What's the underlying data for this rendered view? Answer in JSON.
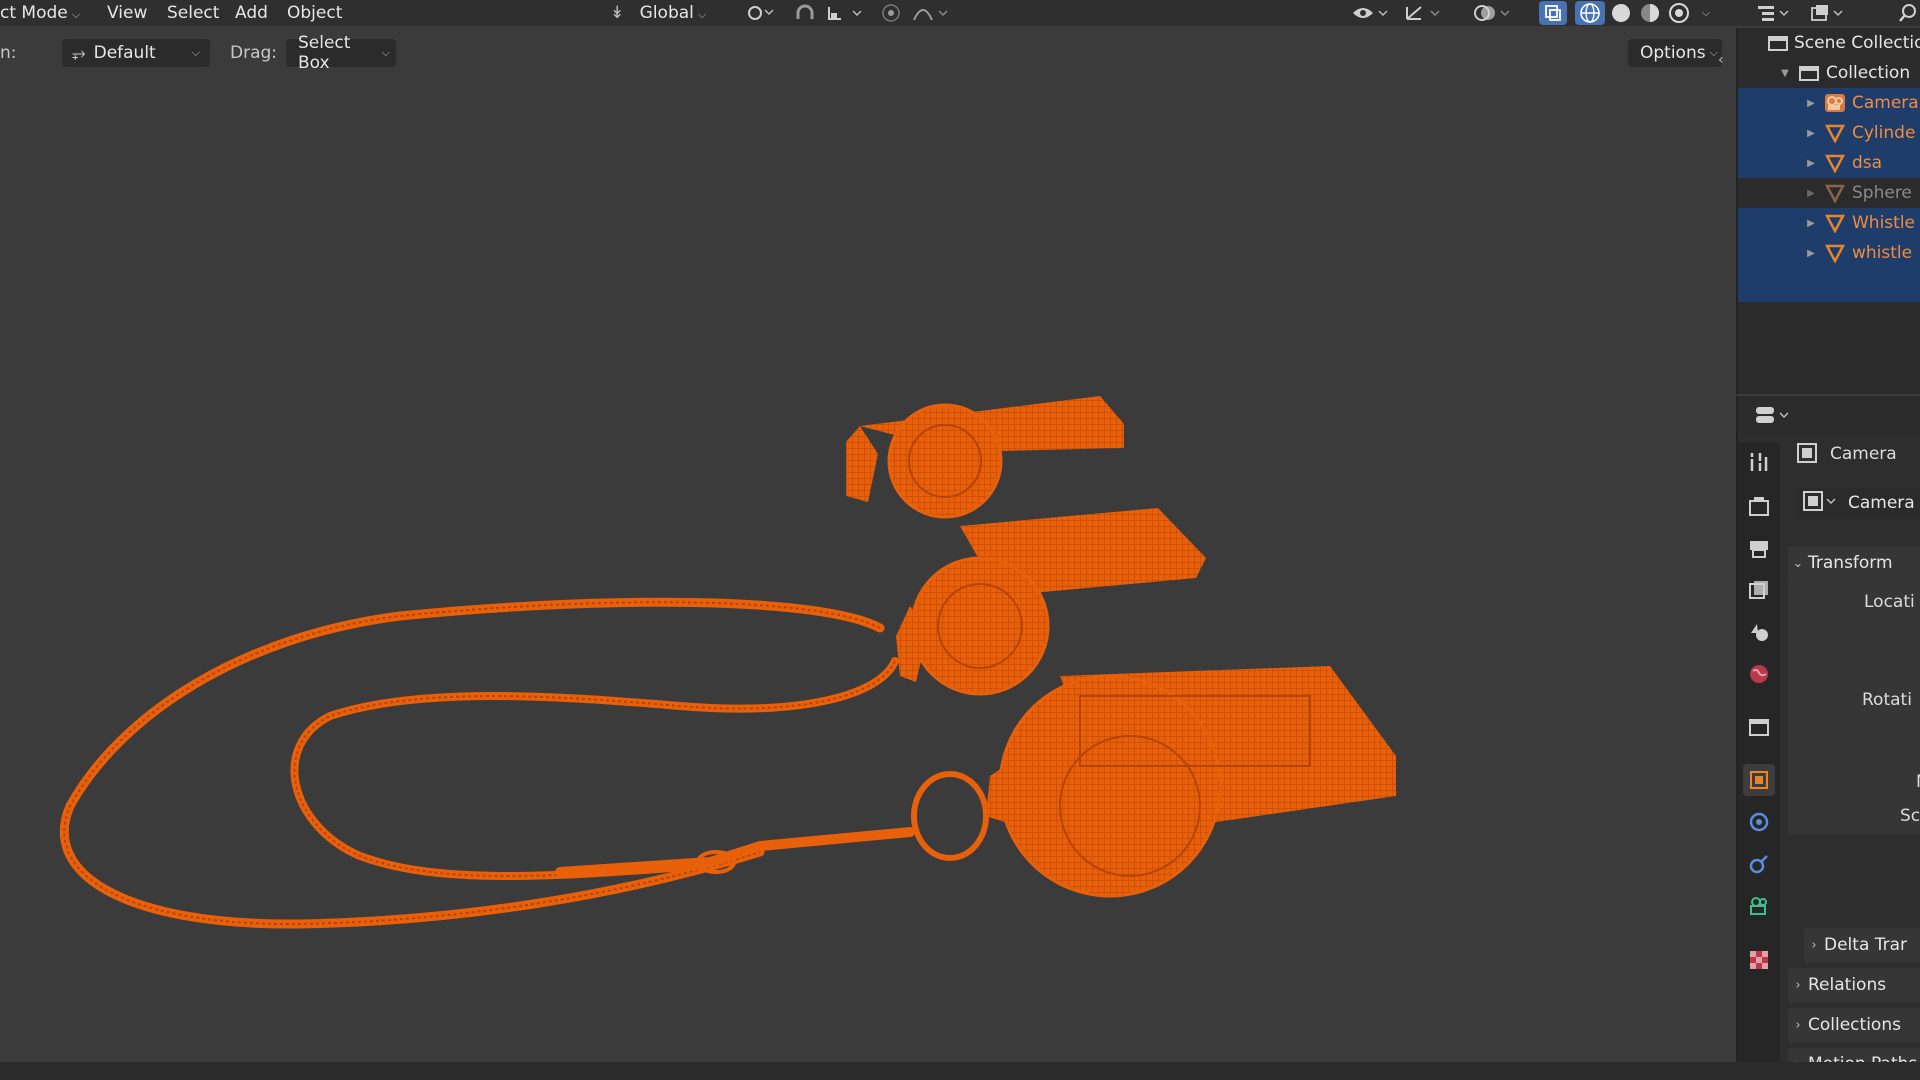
{
  "header": {
    "mode": "ct Mode",
    "menus": [
      "View",
      "Select",
      "Add",
      "Object"
    ],
    "orientation": "Global"
  },
  "toolsettings": {
    "orient_label": "n:",
    "orient_value": "Default",
    "drag_label": "Drag:",
    "drag_value": "Select Box",
    "options": "Options"
  },
  "outliner": {
    "scene_collection": "Scene Collectio",
    "collection": "Collection",
    "items": [
      {
        "label": "Camera",
        "icon": "camera-icon",
        "selected": true,
        "dim": false
      },
      {
        "label": "Cylinde",
        "icon": "mesh-icon",
        "selected": true,
        "dim": false
      },
      {
        "label": "dsa",
        "icon": "mesh-icon",
        "selected": true,
        "dim": false
      },
      {
        "label": "Sphere",
        "icon": "mesh-icon",
        "selected": false,
        "dim": true
      },
      {
        "label": "Whistle",
        "icon": "mesh-icon",
        "selected": true,
        "dim": false
      },
      {
        "label": "whistle",
        "icon": "mesh-icon",
        "selected": true,
        "dim": false
      }
    ]
  },
  "properties": {
    "object_name": "Camera",
    "datablock_name": "Camera",
    "transform_header": "Transform",
    "location_label": "Locati",
    "rotation_label": "Rotati",
    "mode_label": "M",
    "scale_label": "Sca",
    "delta_transform": "Delta Trar",
    "relations": "Relations",
    "collections": "Collections",
    "motion_paths": "Motion Paths"
  },
  "colors": {
    "selection_orange": "#e8600a",
    "accent_blue": "#4772b3",
    "outliner_selected": "#1f3d6b",
    "active_label": "#f08c3c"
  }
}
